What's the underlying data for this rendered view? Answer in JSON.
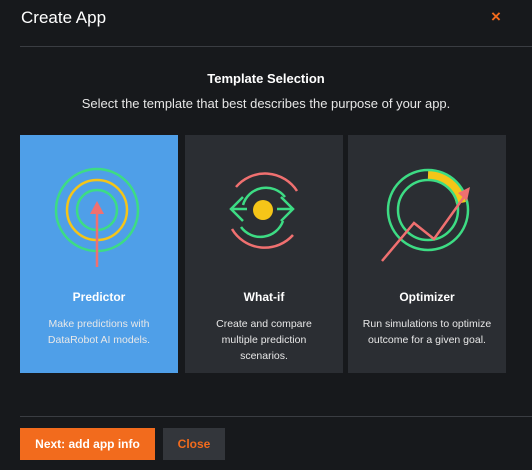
{
  "dialog": {
    "title": "Create App",
    "close_symbol": "×"
  },
  "template_selection": {
    "heading": "Template Selection",
    "subheading": "Select the template that best describes the purpose of your app."
  },
  "cards": [
    {
      "title": "Predictor",
      "description": "Make predictions with DataRobot AI models.",
      "icon": "predictor-target-icon",
      "selected": true
    },
    {
      "title": "What-if",
      "description": "Create and compare multiple prediction scenarios.",
      "icon": "what-if-cycle-icon",
      "selected": false
    },
    {
      "title": "Optimizer",
      "description": "Run simulations to optimize outcome for a given goal.",
      "icon": "optimizer-gauge-icon",
      "selected": false
    }
  ],
  "footer": {
    "primary_label": "Next: add app info",
    "secondary_label": "Close"
  },
  "colors": {
    "accent": "#f26b1d",
    "selected_card": "#4f9fe8",
    "card_bg": "#2b2e33",
    "background": "#17191c",
    "icon_green": "#3ddc84",
    "icon_yellow": "#f5c518",
    "icon_red": "#f07070"
  }
}
